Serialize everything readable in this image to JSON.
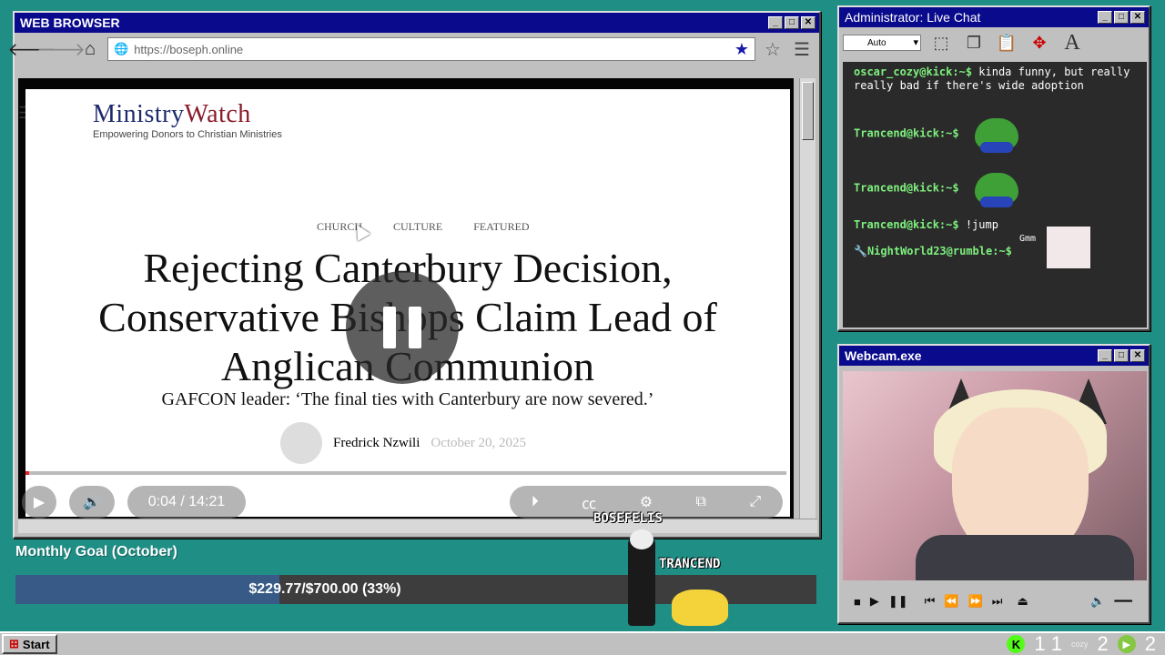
{
  "browser": {
    "title": "WEB BROWSER",
    "url": "https://boseph.online",
    "site_logo_name": "MinistryWatch",
    "site_logo_name_part1": "Ministry",
    "site_logo_name_part2": "Watch",
    "site_tagline": "Empowering Donors to Christian Ministries",
    "categories": [
      "CHURCH",
      "CULTURE",
      "FEATURED"
    ],
    "headline": "Rejecting Canterbury Decision, Conservative Bishops Claim Lead of Anglican Communion",
    "subheadline": "GAFCON leader: ‘The final ties with Canterbury are now severed.’",
    "author": "Fredrick Nzwili",
    "date": "October 20, 2025",
    "video_time": "0:04 / 14:21",
    "video_progress": 0.005
  },
  "chat": {
    "title": "Administrator: Live Chat",
    "font_select": "Auto",
    "messages": [
      {
        "user": "oscar_cozy@kick:~$",
        "text": "kinda funny, but really really bad if there's wide adoption",
        "emote": ""
      },
      {
        "user": "Trancend@kick:~$",
        "text": "",
        "emote": "pepe-emote"
      },
      {
        "user": "Trancend@kick:~$",
        "text": "",
        "emote": "pepe-emote"
      },
      {
        "user": "Trancend@kick:~$",
        "text": "!jump",
        "emote": ""
      },
      {
        "user": "NightWorld23@rumble:~$",
        "text": "Gmm",
        "emote": "cat-emote"
      }
    ]
  },
  "webcam": {
    "title": "Webcam.exe"
  },
  "goal": {
    "title": "Monthly Goal (October)",
    "text": "$229.77/$700.00 (33%)",
    "progress": 0.33
  },
  "overlay": {
    "player1": "BOSEFELIS",
    "player2": "TRANCEND"
  },
  "taskbar": {
    "start": "Start",
    "kick_count": "1 1",
    "rumble_count": "2",
    "other_count": "2",
    "cozy_label": "cozy"
  }
}
